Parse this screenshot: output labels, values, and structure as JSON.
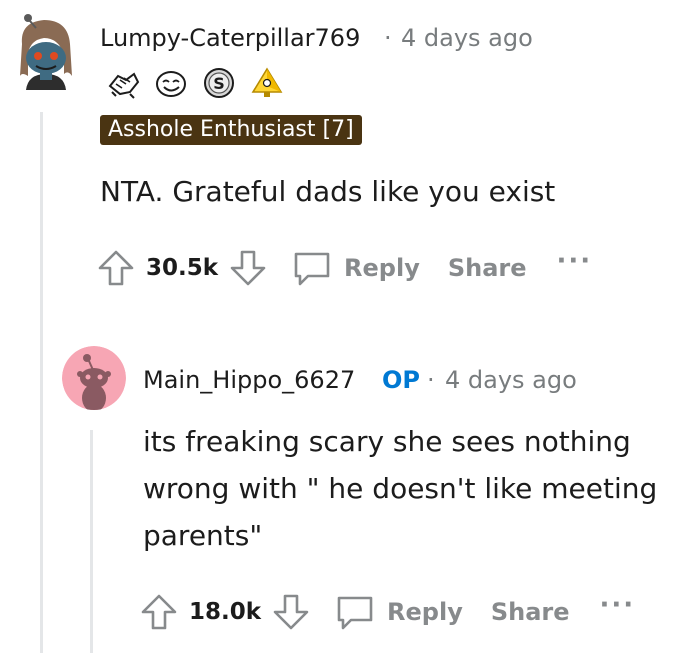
{
  "comments": [
    {
      "username": "Lumpy-Caterpillar769",
      "separator": "·",
      "timestamp": "4 days ago",
      "flair": "Asshole Enthusiast [7]",
      "awards": [
        "wholesome-handshake-award",
        "smiley-face-award",
        "silver-coin-award",
        "gold-pyramid-award"
      ],
      "body": "NTA. Grateful dads like you exist",
      "score": "30.5k",
      "reply_label": "Reply",
      "share_label": "Share",
      "more_label": "···"
    },
    {
      "username": "Main_Hippo_6627",
      "op_label": "OP",
      "separator": "·",
      "timestamp": "4 days ago",
      "body_lines": [
        "its freaking scary she sees nothing",
        "wrong with \" he doesn't like meeting",
        "parents\""
      ],
      "score": "18.0k",
      "reply_label": "Reply",
      "share_label": "Share",
      "more_label": "···"
    }
  ],
  "colors": {
    "op_badge": "#0079d3",
    "flair_bg": "#4a3412",
    "thread_line": "#e4e6e8",
    "muted_text": "#878a8c",
    "avatar2_bg": "#f7a6b4"
  }
}
